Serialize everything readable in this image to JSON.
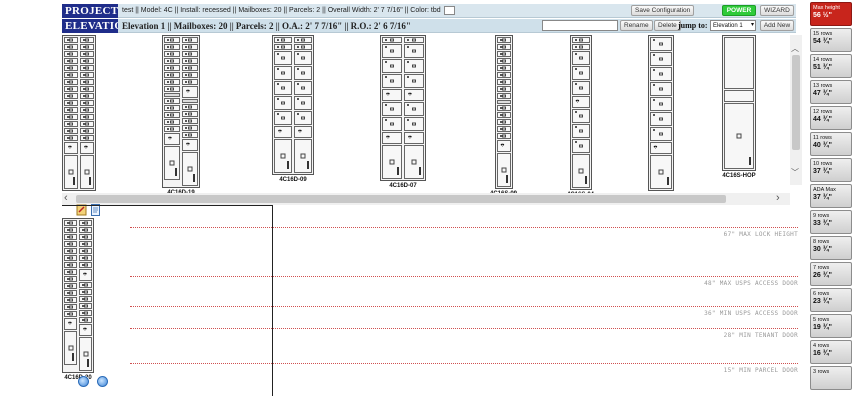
{
  "header": {
    "project_label": "PROJECT",
    "project_info": "test || Model: 4C || Install: recessed || Mailboxes: 20 || Parcels: 2 || Overall Width: 2' 7 7/16\" || Color: tbd",
    "save_configuration": "Save Configuration",
    "power": "POWER",
    "wizard": "WIZARD",
    "elevation_label": "ELEVATION",
    "elevation_info": "Elevation 1 || Mailboxes: 20 || Parcels: 2 || O.A.: 2' 7 7/16\" || R.O.: 2' 6 7/16\"",
    "rename": "Rename",
    "delete": "Delete",
    "jump_to": "jump to:",
    "jump_value": "Elevation 1",
    "add_new": "Add New"
  },
  "units": [
    {
      "label": "4C16D-20"
    },
    {
      "label": "4C16D-19"
    },
    {
      "label": "4C16D-09"
    },
    {
      "label": "4C16D-07"
    },
    {
      "label": "4C16S-09"
    },
    {
      "label": "4C16S-04"
    },
    {
      "label": "4C16S-03"
    },
    {
      "label": "4C16S-HOP"
    }
  ],
  "guides": [
    {
      "label": "67\" MAX LOCK HEIGHT"
    },
    {
      "label": "48\" MAX USPS ACCESS DOOR"
    },
    {
      "label": "36\" MIN USPS ACCESS DOOR"
    },
    {
      "label": "28\" MIN TENANT DOOR"
    },
    {
      "label": "15\" MIN PARCEL DOOR"
    }
  ],
  "preview": {
    "label": "4C16D-20"
  },
  "sidebar": [
    {
      "title": "Max height",
      "value": "56 ½\""
    },
    {
      "title": "15 rows",
      "value": "54 ¾\""
    },
    {
      "title": "14 rows",
      "value": "51 ¾\""
    },
    {
      "title": "13 rows",
      "value": "47 ¾\""
    },
    {
      "title": "12 rows",
      "value": "44 ¾\""
    },
    {
      "title": "11 rows",
      "value": "40 ¾\""
    },
    {
      "title": "10 rows",
      "value": "37 ¾\""
    },
    {
      "title": "ADA Max",
      "value": "37 ¾\""
    },
    {
      "title": "9 rows",
      "value": "33 ¾\""
    },
    {
      "title": "8 rows",
      "value": "30 ¾\""
    },
    {
      "title": "7 rows",
      "value": "26 ¾\""
    },
    {
      "title": "6 rows",
      "value": "23 ¾\""
    },
    {
      "title": "5 rows",
      "value": "19 ¾\""
    },
    {
      "title": "4 rows",
      "value": "16 ¾\""
    },
    {
      "title": "3 rows",
      "value": ""
    }
  ],
  "colors": {
    "header_blue": "#1f2d8a",
    "power_green": "#2fcb3a",
    "max_red": "#c8251c",
    "guide_red": "#d05050"
  }
}
